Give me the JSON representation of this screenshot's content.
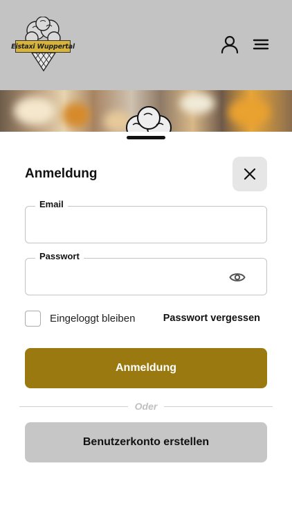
{
  "header": {
    "logo_text": "Eistaxi Wuppertal",
    "user_icon": "user-icon",
    "menu_icon": "menu-icon"
  },
  "sheet": {
    "title": "Anmeldung",
    "close_icon": "close-icon"
  },
  "form": {
    "email_label": "Email",
    "email_value": "",
    "password_label": "Passwort",
    "password_value": "",
    "password_toggle_icon": "eye-icon",
    "remember_label": "Eingeloggt bleiben",
    "remember_checked": false,
    "forgot_label": "Passwort vergessen",
    "submit_label": "Anmeldung"
  },
  "divider": {
    "text": "Oder"
  },
  "register": {
    "label": "Benutzerkonto erstellen"
  },
  "colors": {
    "header_bg": "#c3c3c3",
    "primary": "#9a7a10",
    "secondary": "#c6c6c6",
    "logo_banner": "#d8b53a"
  }
}
